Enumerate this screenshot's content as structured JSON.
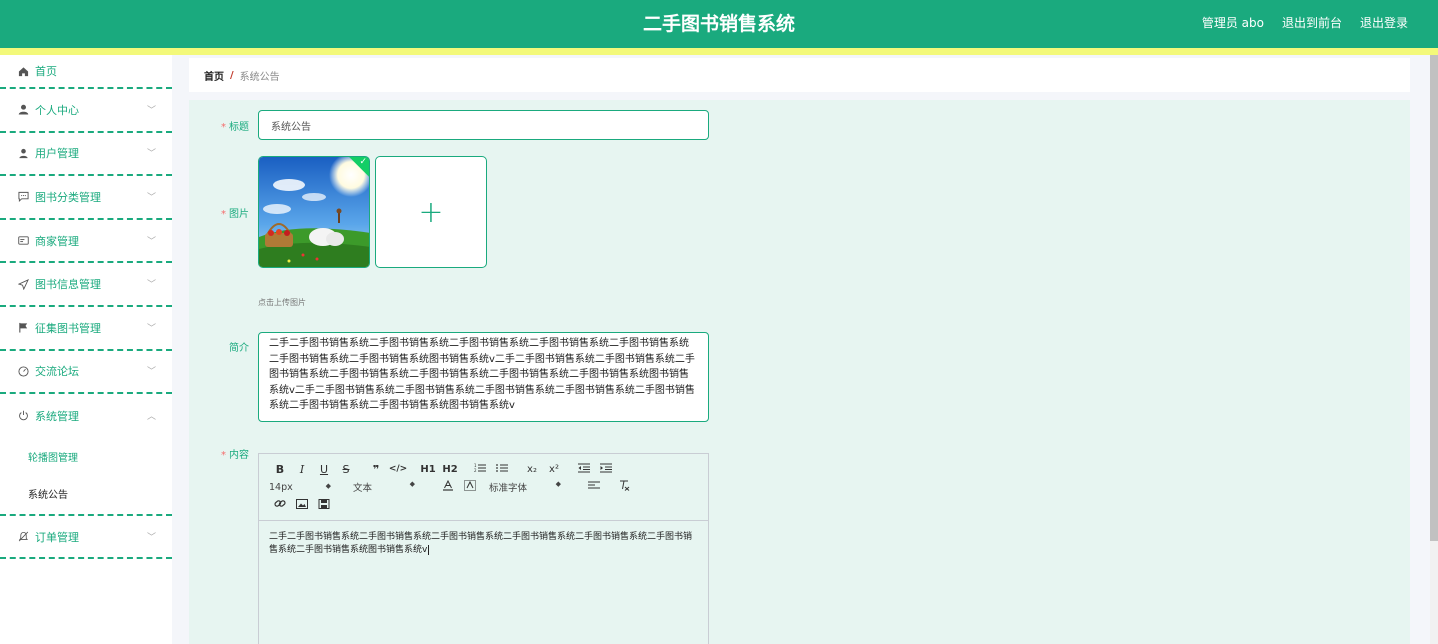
{
  "header": {
    "title": "二手图书销售系统",
    "user": "管理员 abo",
    "to_front": "退出到前台",
    "logout": "退出登录"
  },
  "sidebar": {
    "items": [
      {
        "label": "首页",
        "icon": "home-icon"
      },
      {
        "label": "个人中心",
        "icon": "user-icon"
      },
      {
        "label": "用户管理",
        "icon": "user-manage-icon"
      },
      {
        "label": "图书分类管理",
        "icon": "chat-icon"
      },
      {
        "label": "商家管理",
        "icon": "card-icon"
      },
      {
        "label": "图书信息管理",
        "icon": "send-icon"
      },
      {
        "label": "征集图书管理",
        "icon": "flag-icon"
      },
      {
        "label": "交流论坛",
        "icon": "gauge-icon"
      },
      {
        "label": "系统管理",
        "icon": "power-icon"
      },
      {
        "label": "订单管理",
        "icon": "mute-icon"
      }
    ],
    "sub_items": [
      "轮播图管理",
      "系统公告"
    ]
  },
  "breadcrumb": {
    "home": "首页",
    "sep": "/",
    "current": "系统公告"
  },
  "form": {
    "title_label": "标题",
    "title_value": "系统公告",
    "image_label": "图片",
    "upload_hint": "点击上传图片",
    "intro_label": "简介",
    "intro_value": "二手二手图书销售系统二手图书销售系统二手图书销售系统二手图书销售系统二手图书销售系统二手图书销售系统二手图书销售系统图书销售系统v二手二手图书销售系统二手图书销售系统二手图书销售系统二手图书销售系统二手图书销售系统二手图书销售系统二手图书销售系统图书销售系统v二手二手图书销售系统二手图书销售系统二手图书销售系统二手图书销售系统二手图书销售系统二手图书销售系统二手图书销售系统图书销售系统v",
    "content_label": "内容",
    "content_value": "二手二手图书销售系统二手图书销售系统二手图书销售系统二手图书销售系统二手图书销售系统二手图书销售系统二手图书销售系统图书销售系统v"
  },
  "editor": {
    "toolbar_row1": [
      "B",
      "I",
      "U",
      "S",
      "❞",
      "</>",
      "H1",
      "H2",
      "ol",
      "ul",
      "x₂",
      "x²",
      "outdent",
      "indent"
    ],
    "size": "14px",
    "format": "文本",
    "font": "标准字体"
  },
  "colors": {
    "primary": "#1aaa7e",
    "accent_bar": "#f3f97a",
    "required": "#f56c6c"
  }
}
